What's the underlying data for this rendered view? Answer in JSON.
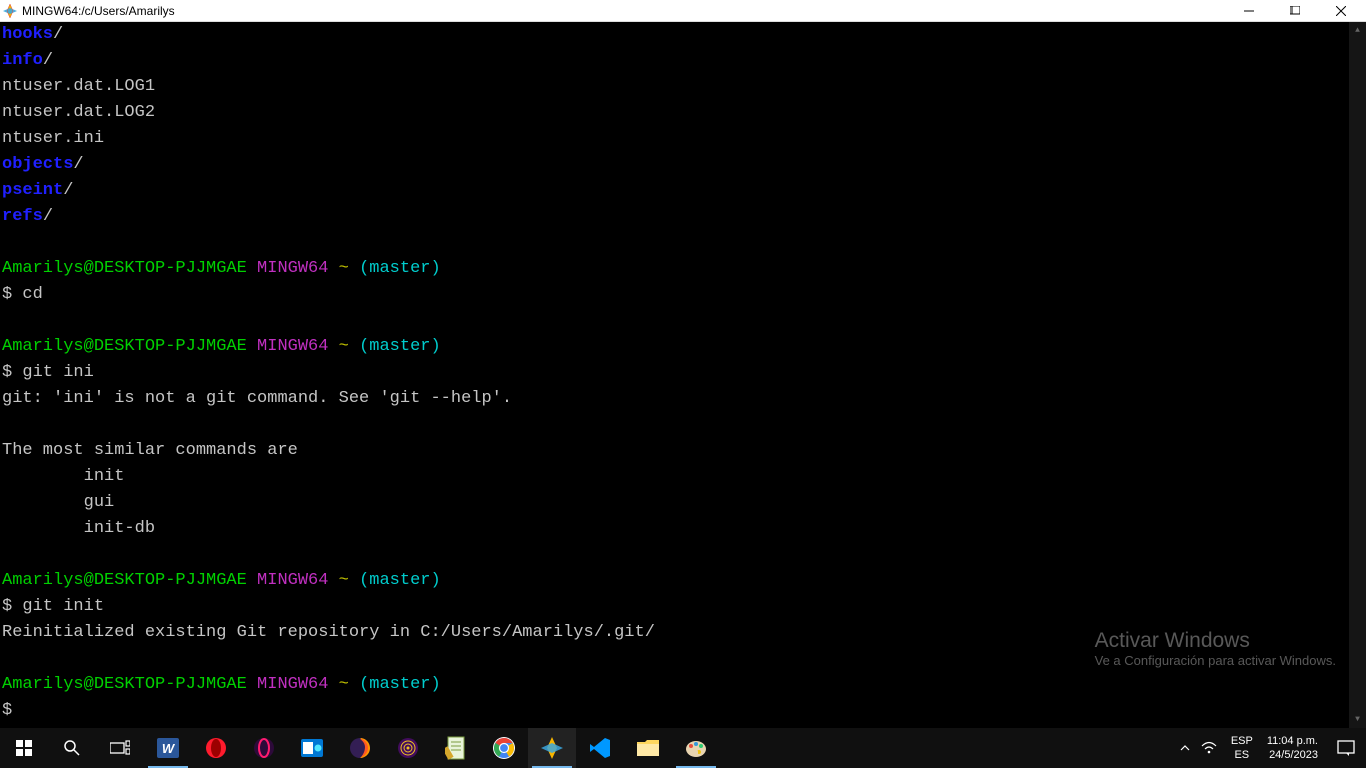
{
  "window": {
    "title": "MINGW64:/c/Users/Amarilys"
  },
  "terminal": {
    "lines": [
      {
        "dir": "hooks",
        "slash": "/"
      },
      {
        "dir": "info",
        "slash": "/"
      },
      {
        "plain": "ntuser.dat.LOG1"
      },
      {
        "plain": "ntuser.dat.LOG2"
      },
      {
        "plain": "ntuser.ini"
      },
      {
        "dir": "objects",
        "slash": "/"
      },
      {
        "dir": "pseint",
        "slash": "/"
      },
      {
        "dir": "refs",
        "slash": "/"
      }
    ],
    "prompts": [
      {
        "user": "Amarilys@DESKTOP-PJJMGAE",
        "env": "MINGW64",
        "path": "~",
        "branch": "(master)",
        "cmd": "$ cd",
        "output": []
      },
      {
        "user": "Amarilys@DESKTOP-PJJMGAE",
        "env": "MINGW64",
        "path": "~",
        "branch": "(master)",
        "cmd": "$ git ini",
        "output": [
          "git: 'ini' is not a git command. See 'git --help'.",
          "",
          "The most similar commands are",
          "        init",
          "        gui",
          "        init-db"
        ]
      },
      {
        "user": "Amarilys@DESKTOP-PJJMGAE",
        "env": "MINGW64",
        "path": "~",
        "branch": "(master)",
        "cmd": "$ git init",
        "output": [
          "Reinitialized existing Git repository in C:/Users/Amarilys/.git/"
        ]
      },
      {
        "user": "Amarilys@DESKTOP-PJJMGAE",
        "env": "MINGW64",
        "path": "~",
        "branch": "(master)",
        "cmd": "$",
        "output": []
      }
    ]
  },
  "watermark": {
    "title": "Activar Windows",
    "subtitle": "Ve a Configuración para activar Windows."
  },
  "tray": {
    "lang1": "ESP",
    "lang2": "ES",
    "time": "11:04 p.m.",
    "date": "24/5/2023"
  }
}
